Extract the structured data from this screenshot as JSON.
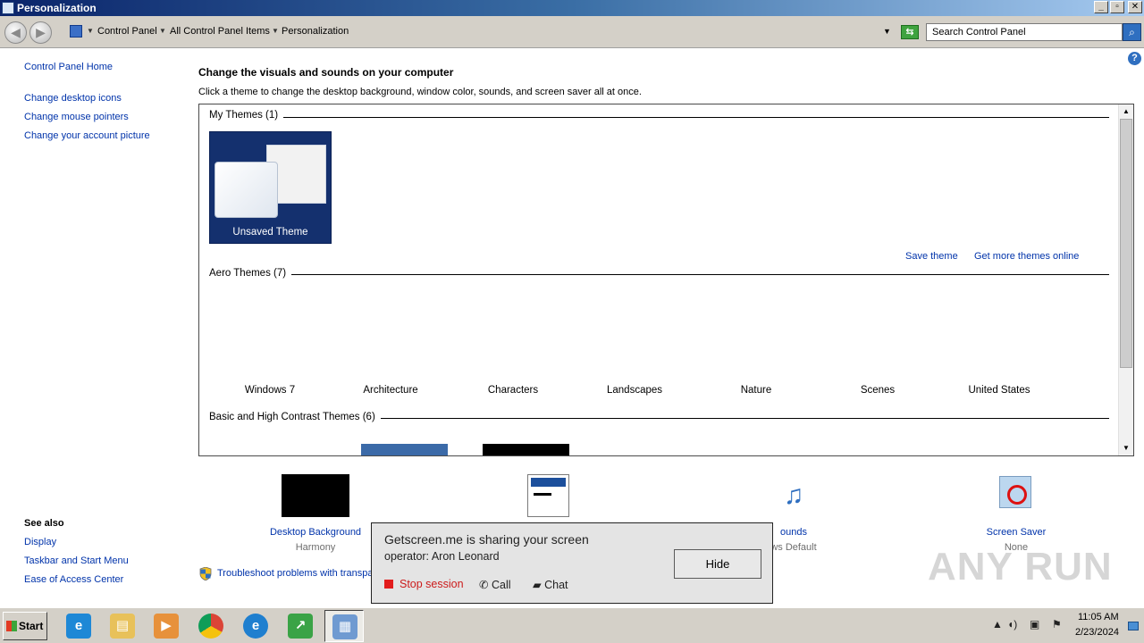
{
  "window": {
    "title": "Personalization",
    "buttons": [
      "_",
      "▫",
      "✕"
    ]
  },
  "address": {
    "crumbs": [
      "Control Panel",
      "All Control Panel Items",
      "Personalization"
    ],
    "search_placeholder": "Search Control Panel"
  },
  "left_nav": {
    "home": "Control Panel Home",
    "links": [
      "Change desktop icons",
      "Change mouse pointers",
      "Change your account picture"
    ]
  },
  "see_also": {
    "title": "See also",
    "links": [
      "Display",
      "Taskbar and Start Menu",
      "Ease of Access Center"
    ]
  },
  "main": {
    "heading": "Change the visuals and sounds on your computer",
    "subheading": "Click a theme to change the desktop background, window color, sounds, and screen saver all at once."
  },
  "themes": {
    "my_themes_title": "My Themes (1)",
    "unsaved_theme": "Unsaved Theme",
    "save_theme": "Save theme",
    "get_more": "Get more themes online",
    "aero_title": "Aero Themes (7)",
    "aero": [
      "Windows 7",
      "Architecture",
      "Characters",
      "Landscapes",
      "Nature",
      "Scenes",
      "United States"
    ],
    "basic_title": "Basic and High Contrast Themes (6)"
  },
  "customize": {
    "desktop_background": {
      "label": "Desktop Background",
      "value": "Harmony"
    },
    "sounds": {
      "label": "ounds",
      "value": "ws Default"
    },
    "screen_saver": {
      "label": "Screen Saver",
      "value": "None"
    },
    "troubleshoot": "Troubleshoot problems with transpa"
  },
  "popup": {
    "line1": "Getscreen.me is sharing your screen",
    "line2": "operator: Aron Leonard",
    "hide": "Hide",
    "stop": "Stop session",
    "call": "Call",
    "chat": "Chat"
  },
  "watermark": "ANY RUN",
  "taskbar": {
    "start": "Start",
    "time": "11:05 AM",
    "date": "2/23/2024"
  },
  "colors": {
    "link": "#0033aa",
    "unsaved_tile": "#14306e",
    "stop_red": "#e21d1d"
  }
}
